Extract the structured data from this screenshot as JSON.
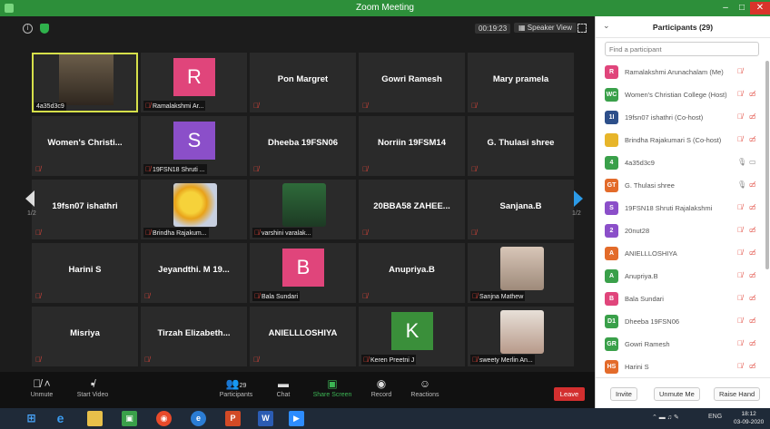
{
  "window": {
    "title": "Zoom Meeting",
    "minimize": "–",
    "maximize": "□",
    "close": "✕"
  },
  "meeting": {
    "timer": "00:19:23",
    "view_label": "Speaker View",
    "page_left": "1/2",
    "page_right": "1/2"
  },
  "tiles": [
    {
      "kind": "video",
      "tag": "4a35d3c9",
      "active": true
    },
    {
      "kind": "letter",
      "letter": "R",
      "color": "#e0457b",
      "tag": "Ramalakshmi Ar..."
    },
    {
      "kind": "name",
      "name": "Pon Margret"
    },
    {
      "kind": "name",
      "name": "Gowri Ramesh"
    },
    {
      "kind": "name",
      "name": "Mary pramela"
    },
    {
      "kind": "name",
      "name": "Women's Christi..."
    },
    {
      "kind": "letter",
      "letter": "S",
      "color": "#8b4fc9",
      "tag": "19FSN18 Shruti ..."
    },
    {
      "kind": "name",
      "name": "Dheeba 19FSN06"
    },
    {
      "kind": "name",
      "name": "Norriin 19FSM14"
    },
    {
      "kind": "name",
      "name": "G. Thulasi shree"
    },
    {
      "kind": "name",
      "name": "19fsn07 ishathri"
    },
    {
      "kind": "photo",
      "photo": "flowers",
      "tag": "Brindha Rajakum..."
    },
    {
      "kind": "photo",
      "photo": "girl",
      "tag": "varshini varalak..."
    },
    {
      "kind": "name",
      "name": "20BBA58 ZAHEE..."
    },
    {
      "kind": "name",
      "name": "Sanjana.B"
    },
    {
      "kind": "name",
      "name": "Harini S"
    },
    {
      "kind": "name",
      "name": "Jeyandthi. M 19..."
    },
    {
      "kind": "letter",
      "letter": "B",
      "color": "#e0457b",
      "tag": "Bala Sundari"
    },
    {
      "kind": "name",
      "name": "Anupriya.B"
    },
    {
      "kind": "photo",
      "photo": "portrait",
      "tag": "Sanjna Mathew"
    },
    {
      "kind": "name",
      "name": "Misriya"
    },
    {
      "kind": "name",
      "name": "Tirzah  Elizabeth..."
    },
    {
      "kind": "name",
      "name": "ANIELLLOSHIYA"
    },
    {
      "kind": "letter",
      "letter": "K",
      "color": "#3a8f3a",
      "tag": "Keren Preetni J"
    },
    {
      "kind": "photo",
      "photo": "smile",
      "tag": "sweety Merlin An..."
    }
  ],
  "toolbar": {
    "unmute": "Unmute",
    "start_video": "Start Video",
    "participants": "Participants",
    "participants_count": "29",
    "chat": "Chat",
    "share_screen": "Share Screen",
    "record": "Record",
    "reactions": "Reactions",
    "leave": "Leave"
  },
  "panel": {
    "title": "Participants (29)",
    "search_placeholder": "Find a participant",
    "invite": "Invite",
    "unmute_me": "Unmute Me",
    "raise_hand": "Raise Hand",
    "participants": [
      {
        "initials": "R",
        "color": "#e0457b",
        "name": "Ramalakshmi Arunachalam (Me)",
        "mic": "muted",
        "cam": ""
      },
      {
        "initials": "WC",
        "color": "#3aa04a",
        "name": "Women's Christian College (Host)",
        "mic": "muted",
        "cam": "off"
      },
      {
        "initials": "1I",
        "color": "#2d4f8a",
        "name": "19fsn07 ishathri (Co-host)",
        "mic": "muted",
        "cam": "off"
      },
      {
        "initials": "",
        "color": "#e7b52a",
        "name": "Brindha Rajakumari S (Co-host)",
        "mic": "muted",
        "cam": "off"
      },
      {
        "initials": "4",
        "color": "#3aa04a",
        "name": "4a35d3c9",
        "mic": "on",
        "cam": "on"
      },
      {
        "initials": "GT",
        "color": "#e36b2a",
        "name": "G. Thulasi shree",
        "mic": "on",
        "cam": "off"
      },
      {
        "initials": "S",
        "color": "#8b4fc9",
        "name": "19FSN18 Shruti Rajalakshmi",
        "mic": "muted",
        "cam": "off"
      },
      {
        "initials": "2",
        "color": "#8b4fc9",
        "name": "20nut28",
        "mic": "muted",
        "cam": "off"
      },
      {
        "initials": "A",
        "color": "#e36b2a",
        "name": "ANIELLLOSHIYA",
        "mic": "muted",
        "cam": "off"
      },
      {
        "initials": "A",
        "color": "#3aa04a",
        "name": "Anupriya.B",
        "mic": "muted",
        "cam": "off"
      },
      {
        "initials": "B",
        "color": "#e0457b",
        "name": "Bala Sundari",
        "mic": "muted",
        "cam": "off"
      },
      {
        "initials": "D1",
        "color": "#3aa04a",
        "name": "Dheeba 19FSN06",
        "mic": "muted",
        "cam": "off"
      },
      {
        "initials": "GR",
        "color": "#3aa04a",
        "name": "Gowri Ramesh",
        "mic": "muted",
        "cam": "off"
      },
      {
        "initials": "HS",
        "color": "#e36b2a",
        "name": "Harini S",
        "mic": "muted",
        "cam": "off"
      }
    ]
  },
  "taskbar": {
    "lang": "ENG",
    "time": "18:12",
    "date": "03-09-2020"
  }
}
